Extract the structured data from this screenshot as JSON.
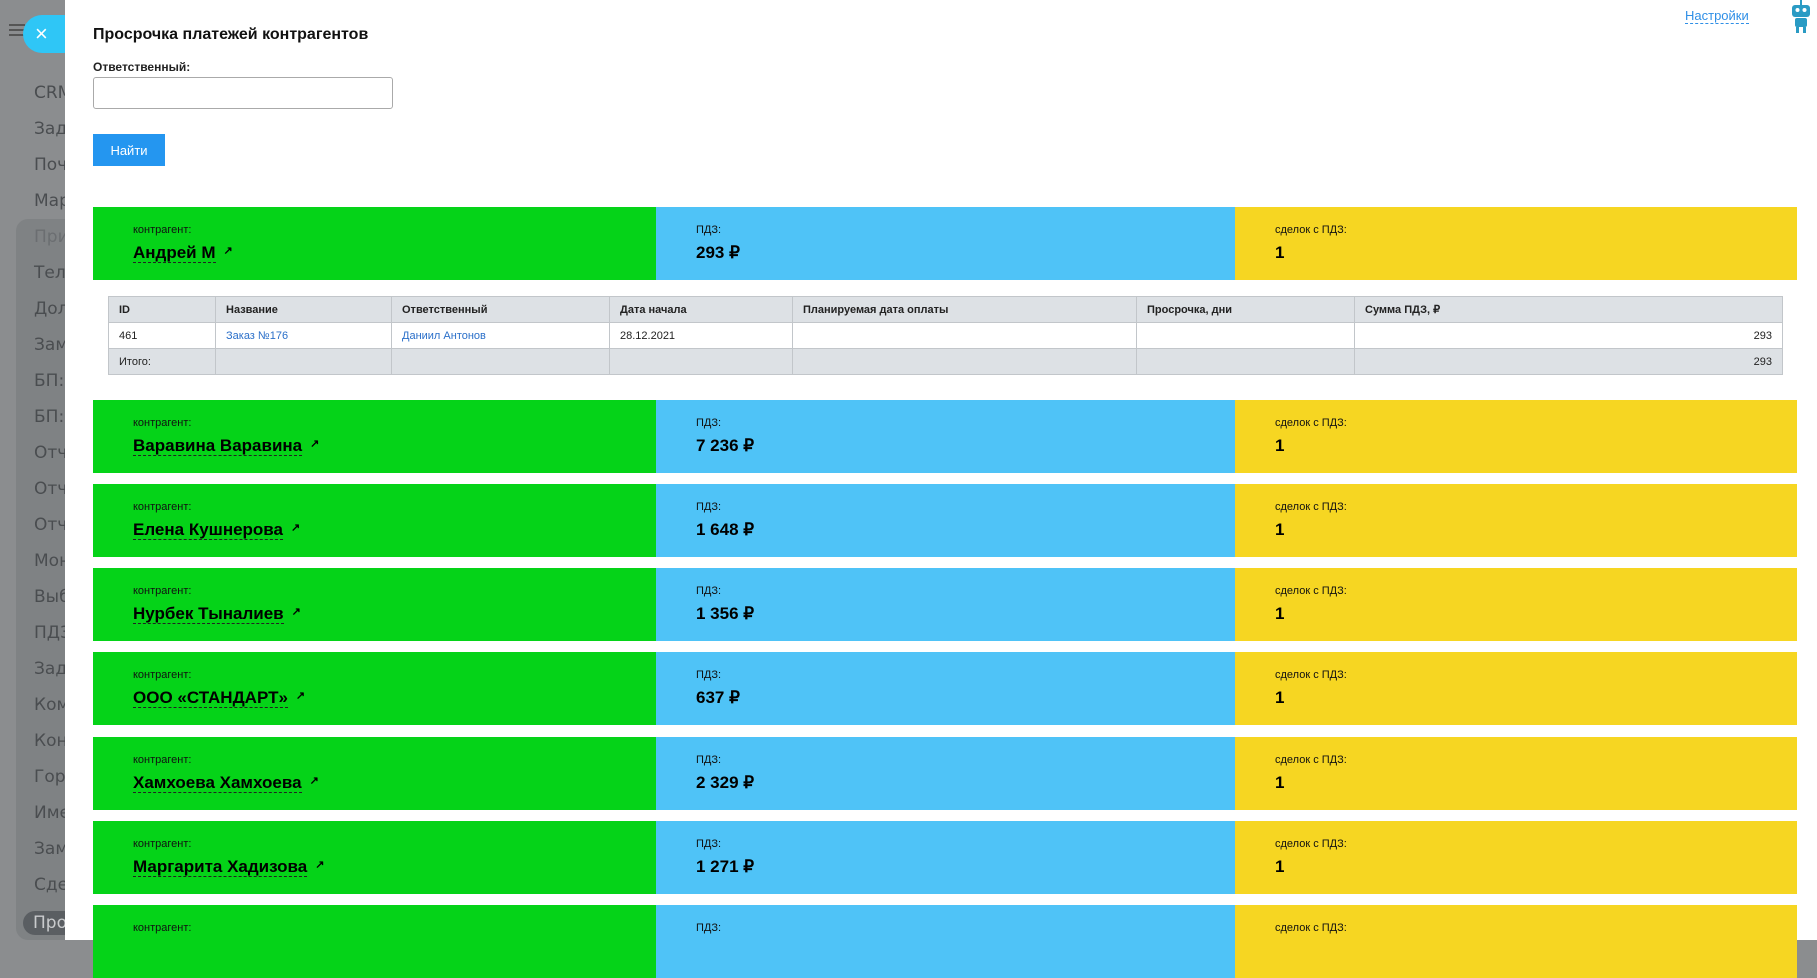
{
  "sidebar": {
    "items": [
      "CRM",
      "Зада",
      "Почт",
      "Мар",
      "При",
      "Теле",
      "Долг",
      "Заме",
      "БП: С",
      "БП: З",
      "Отче",
      "Отче",
      "Отче",
      "Мон",
      "Выб",
      "ПДЗ",
      "Зада",
      "Ком",
      "Конт",
      "Горо",
      "Име",
      "Заме",
      "Сдел",
      "Прос"
    ]
  },
  "close_label": "×",
  "page": {
    "title": "Просрочка платежей контрагентов",
    "responsible_label": "Ответственный:",
    "responsible_value": "",
    "find_button": "Найти",
    "settings_link": "Настройки"
  },
  "labels": {
    "counterparty": "контрагент:",
    "pdz": "ПДЗ:",
    "deals": "сделок с ПДЗ:",
    "ext": "↗"
  },
  "blocks": [
    {
      "name": "Андрей М",
      "pdz": "293 ₽",
      "deals": "1"
    },
    {
      "name": "Варавина Варавина",
      "pdz": "7 236 ₽",
      "deals": "1"
    },
    {
      "name": "Елена Кушнерова",
      "pdz": "1 648 ₽",
      "deals": "1"
    },
    {
      "name": "Нурбек Тыналиев",
      "pdz": "1 356 ₽",
      "deals": "1"
    },
    {
      "name": "ООО «СТАНДАРТ»",
      "pdz": "637 ₽",
      "deals": "1"
    },
    {
      "name": "Хамхоева Хамхоева",
      "pdz": "2 329 ₽",
      "deals": "1"
    },
    {
      "name": "Маргарита Хадизова",
      "pdz": "1 271 ₽",
      "deals": "1"
    },
    {
      "name": "",
      "pdz": "",
      "deals": ""
    }
  ],
  "table": {
    "headers": [
      "ID",
      "Название",
      "Ответственный",
      "Дата начала",
      "Планируемая дата оплаты",
      "Просрочка, дни",
      "Сумма ПДЗ, ₽"
    ],
    "rows": [
      [
        "461",
        "Заказ №176",
        "Даниил Антонов",
        "28.12.2021",
        "",
        "",
        "293"
      ]
    ],
    "total": [
      "Итого:",
      "",
      "",
      "",
      "",
      "",
      "293"
    ]
  },
  "colors": {
    "green": "#05d318",
    "blue": "#4fc3f7",
    "yellow": "#f6d622",
    "accent": "#2496f0"
  }
}
